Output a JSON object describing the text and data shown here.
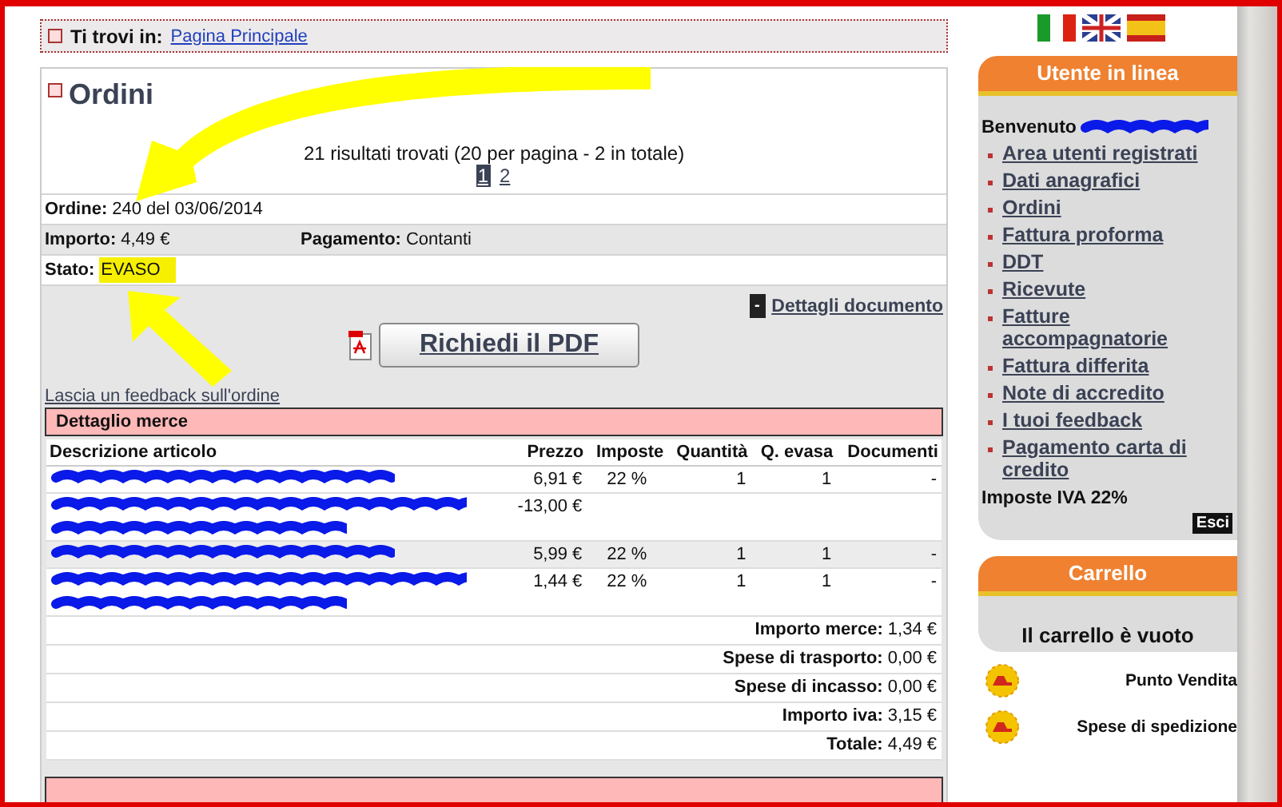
{
  "breadcrumb": {
    "label": "Ti trovi in:",
    "link": "Pagina Principale"
  },
  "title": "Ordini",
  "results": "21 risultati trovati (20 per pagina - 2 in totale)",
  "pages": [
    {
      "label": "1",
      "selected": true
    },
    {
      "label": "2",
      "selected": false
    }
  ],
  "order_rows": [
    [
      {
        "label": "Ordine:",
        "value": "240 del 03/06/2014"
      }
    ],
    [
      {
        "label": "Importo:",
        "value": "4,49 €"
      },
      {
        "label": "Pagamento:",
        "value": "Contanti"
      }
    ],
    [
      {
        "label": "Stato:",
        "value": "EVASO",
        "highlighted": true
      }
    ]
  ],
  "details_toggle": {
    "icon": "-",
    "label": "Dettagli documento"
  },
  "pdf_button": "Richiedi il PDF",
  "feedback_link": "Lascia un feedback sull'ordine",
  "goods_section": "Dettaglio merce",
  "columns": [
    "Descrizione articolo",
    "Prezzo",
    "Imposte",
    "Quantità",
    "Q. evasa",
    "Documenti"
  ],
  "items": [
    {
      "kind": "single",
      "shaded": false,
      "price": "6,91 €",
      "tax": "22 %",
      "qty": "1",
      "qty_shipped": "1",
      "documents": "-"
    },
    {
      "kind": "double",
      "shaded": false,
      "price": "-13,00 €"
    },
    {
      "kind": "single",
      "shaded": true,
      "price": "5,99 €",
      "tax": "22 %",
      "qty": "1",
      "qty_shipped": "1",
      "documents": "-"
    },
    {
      "kind": "double",
      "shaded": false,
      "price": "1,44 €",
      "tax": "22 %",
      "qty": "1",
      "qty_shipped": "1",
      "documents": "-"
    }
  ],
  "totals": [
    {
      "label": "Importo merce:",
      "value": "1,34 €"
    },
    {
      "label": "Spese di trasporto:",
      "value": "0,00 €"
    },
    {
      "label": "Spese di incasso:",
      "value": "0,00 €"
    },
    {
      "label": "Importo iva:",
      "value": "3,15 €"
    },
    {
      "label": "Totale:",
      "value": "4,49 €"
    }
  ],
  "sidebar": {
    "user_box": {
      "title": "Utente in linea",
      "welcome": "Benvenuto",
      "links": [
        "Area utenti registrati",
        "Dati anagrafici",
        "Ordini",
        "Fattura proforma",
        "DDT",
        "Ricevute",
        "Fatture accompagnatorie",
        "Fattura differita",
        "Note di accredito",
        "I tuoi feedback",
        "Pagamento carta di credito"
      ],
      "tax_note": "Imposte IVA 22%",
      "logout": "Esci"
    },
    "cart": {
      "title": "Carrello",
      "empty": "Il carrello è vuoto"
    },
    "services": [
      "Punto Vendita",
      "Spese di spedizione"
    ]
  }
}
